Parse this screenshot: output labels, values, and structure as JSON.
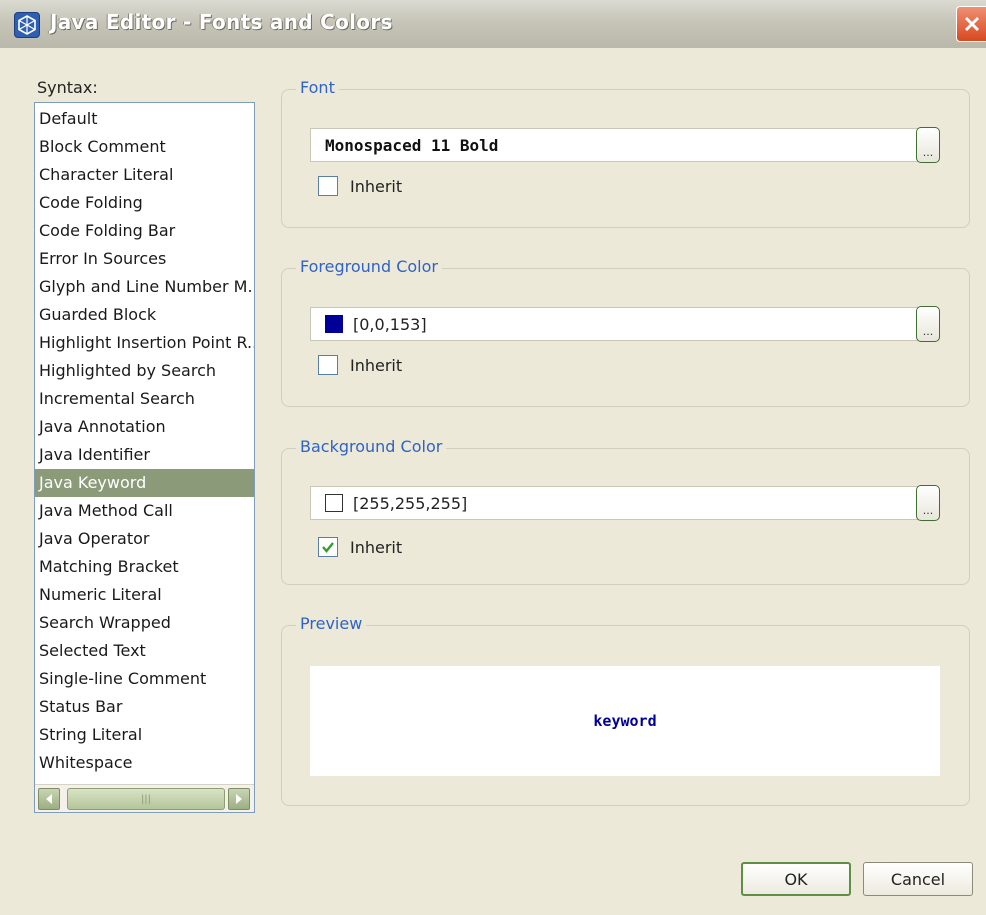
{
  "window": {
    "title": "Java Editor - Fonts and Colors"
  },
  "syntax": {
    "label": "Syntax:",
    "items": [
      {
        "label": "Default"
      },
      {
        "label": "Block Comment"
      },
      {
        "label": "Character Literal"
      },
      {
        "label": "Code Folding"
      },
      {
        "label": "Code Folding Bar"
      },
      {
        "label": "Error In Sources"
      },
      {
        "label": "Glyph and Line Number M..."
      },
      {
        "label": "Guarded Block"
      },
      {
        "label": "Highlight Insertion Point R..."
      },
      {
        "label": "Highlighted by Search"
      },
      {
        "label": "Incremental Search"
      },
      {
        "label": "Java Annotation"
      },
      {
        "label": "Java Identifier"
      },
      {
        "label": "Java Keyword"
      },
      {
        "label": "Java Method Call"
      },
      {
        "label": "Java Operator"
      },
      {
        "label": "Matching Bracket"
      },
      {
        "label": "Numeric Literal"
      },
      {
        "label": "Search Wrapped"
      },
      {
        "label": "Selected Text"
      },
      {
        "label": "Single-line Comment"
      },
      {
        "label": "Status Bar"
      },
      {
        "label": "String Literal"
      },
      {
        "label": "Whitespace"
      }
    ],
    "selected": "Java Keyword"
  },
  "font": {
    "legend": "Font",
    "value": "Monospaced 11 Bold",
    "inherit_label": "Inherit",
    "inherit_checked": false
  },
  "foreground": {
    "legend": "Foreground Color",
    "value": "[0,0,153]",
    "swatch_color": "#000099",
    "inherit_label": "Inherit",
    "inherit_checked": false
  },
  "background": {
    "legend": "Background Color",
    "value": "[255,255,255]",
    "swatch_color": "#ffffff",
    "inherit_label": "Inherit",
    "inherit_checked": true
  },
  "preview": {
    "legend": "Preview",
    "text": "keyword",
    "text_color": "#000099"
  },
  "buttons": {
    "ok": "OK",
    "cancel": "Cancel"
  },
  "colors": {
    "selection_bg": "#8b9a78",
    "legend_text": "#2f63c6"
  }
}
